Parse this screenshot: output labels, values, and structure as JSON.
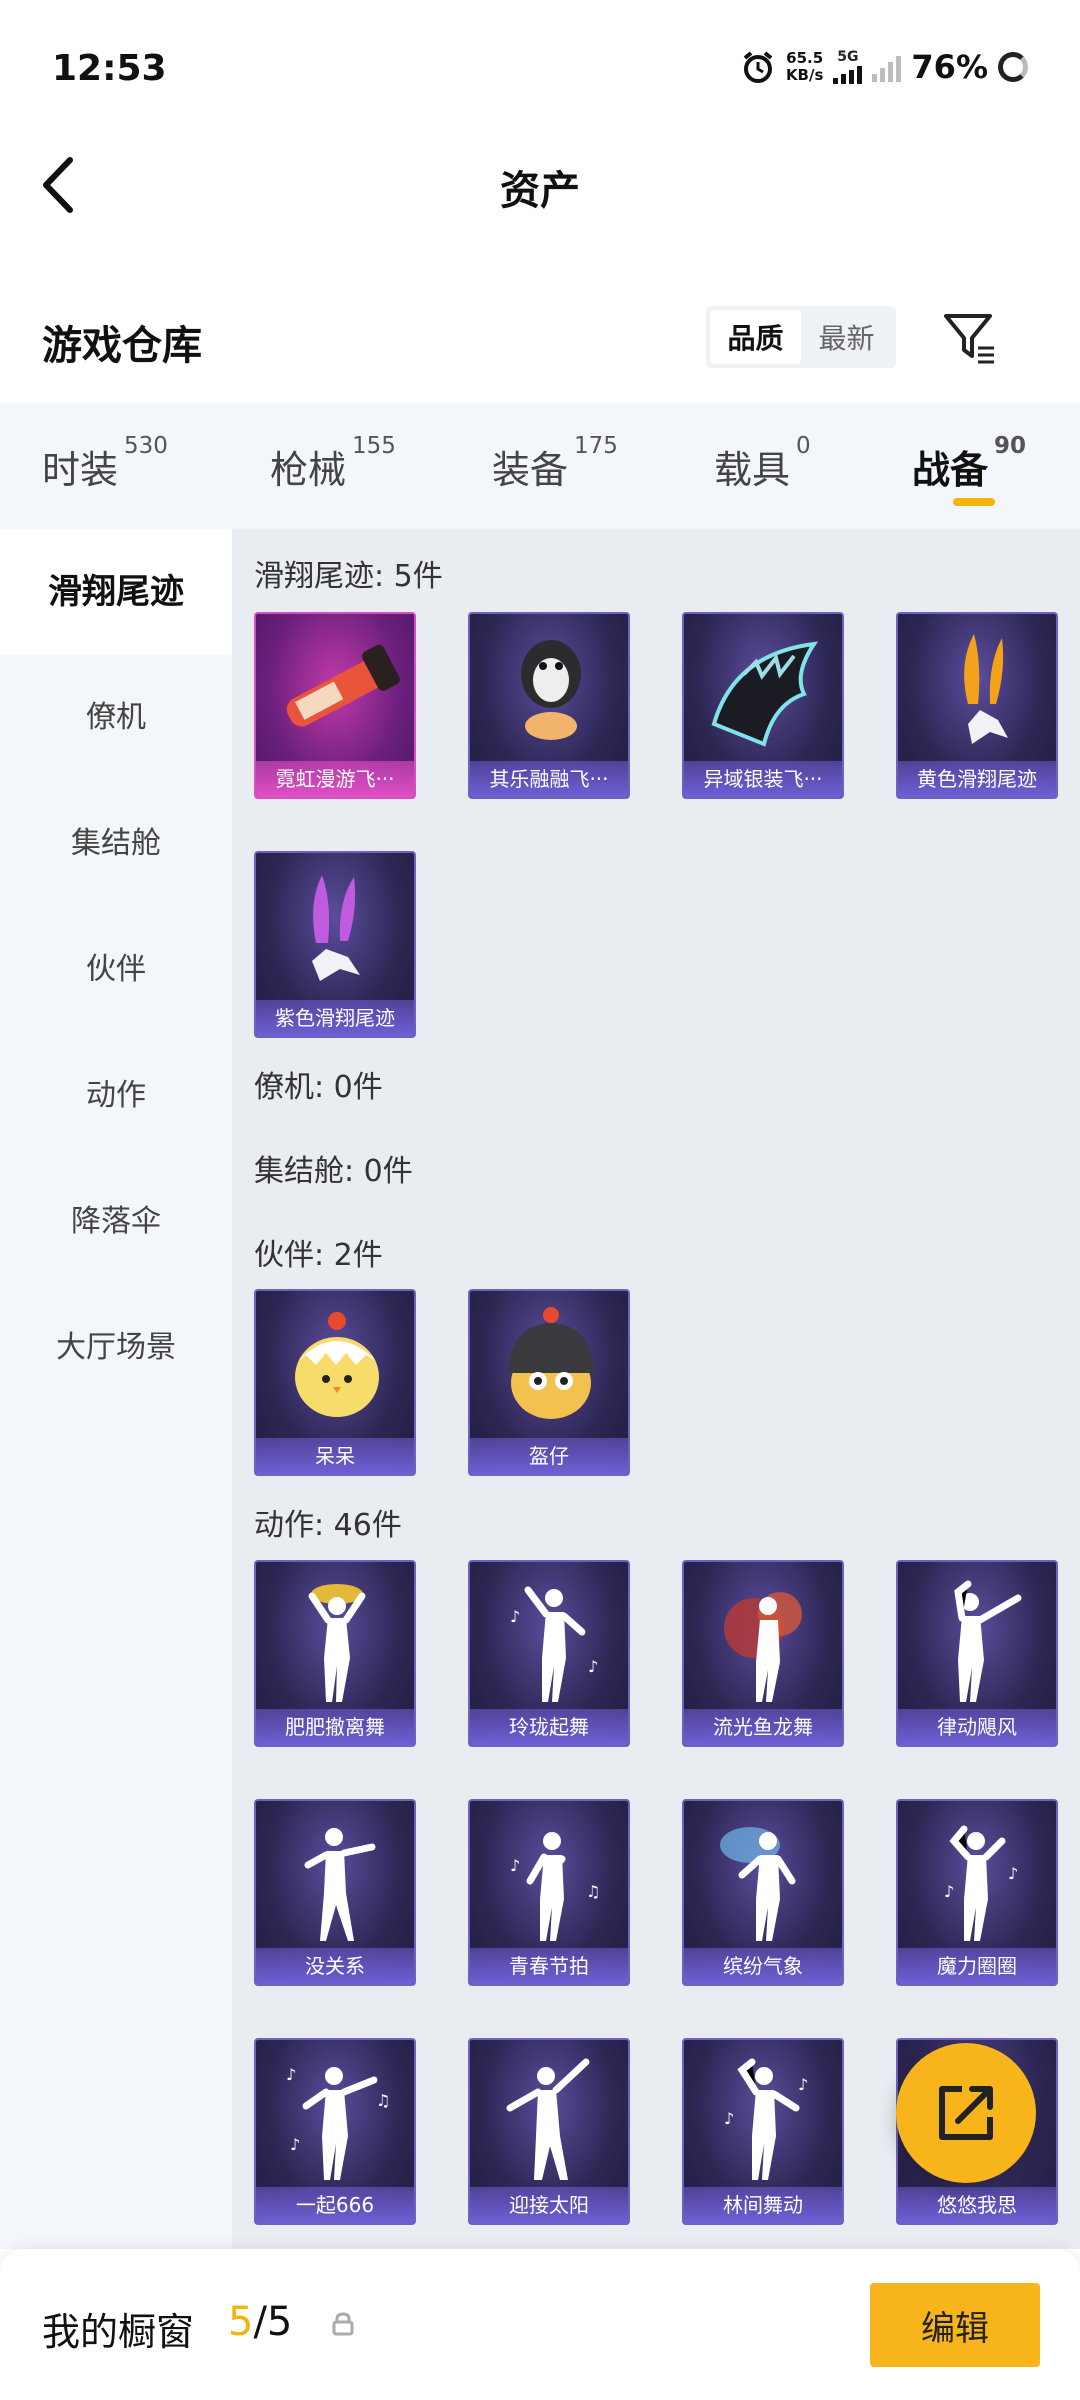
{
  "status": {
    "time": "12:53",
    "net_speed_value": "65.5",
    "net_speed_unit": "KB/s",
    "network_type": "5G",
    "battery": "76%"
  },
  "header": {
    "title": "资产"
  },
  "section": {
    "title": "游戏仓库",
    "sort_options": [
      "品质",
      "最新"
    ],
    "sort_selected": "品质"
  },
  "tabs": [
    {
      "label": "时装",
      "count": "530"
    },
    {
      "label": "枪械",
      "count": "155"
    },
    {
      "label": "装备",
      "count": "175"
    },
    {
      "label": "载具",
      "count": "0"
    },
    {
      "label": "战备",
      "count": "90"
    }
  ],
  "active_tab": "战备",
  "sidebar": [
    "滑翔尾迹",
    "僚机",
    "集结舱",
    "伙伴",
    "动作",
    "降落伞",
    "大厅场景"
  ],
  "groups": {
    "glide": {
      "label": "滑翔尾迹: 5件",
      "items": [
        "霓虹漫游飞···",
        "其乐融融飞···",
        "异域银装飞···",
        "黄色滑翔尾迹",
        "紫色滑翔尾迹"
      ]
    },
    "wingman": {
      "label": "僚机: 0件"
    },
    "capsule": {
      "label": "集结舱: 0件"
    },
    "partner": {
      "label": "伙伴: 2件",
      "items": [
        "呆呆",
        "盔仔"
      ]
    },
    "action": {
      "label": "动作: 46件",
      "items": [
        "肥肥撤离舞",
        "玲珑起舞",
        "流光鱼龙舞",
        "律动飓风",
        "没关系",
        "青春节拍",
        "缤纷气象",
        "魔力圈圈",
        "一起666",
        "迎接太阳",
        "林间舞动",
        "悠悠我思"
      ]
    }
  },
  "bottom": {
    "label": "我的橱窗",
    "count_current": "5",
    "count_total": "/5",
    "edit_label": "编辑"
  },
  "colors": {
    "accent": "#f5b40a",
    "card_bg": "#2c2652",
    "card_caption": "#6f5fd6"
  }
}
